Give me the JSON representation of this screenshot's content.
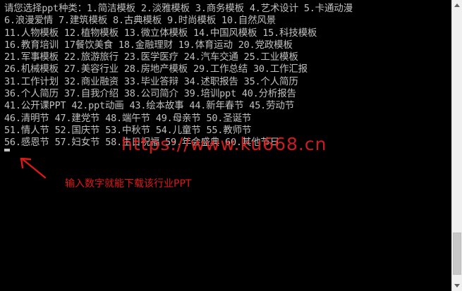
{
  "console": {
    "lines": [
      "请您选择ppt种类：1.简洁模板 2.淡雅模板 3.商务模板 4.艺术设计 5.卡通动漫",
      "6.浪漫爱情 7.建筑模板 8.古典模板 9.时尚模板 10.自然风景",
      "11.人物模板 12.植物模板 13.微立体模板 14.中国风模板 15.科技模板",
      "16.教育培训 17餐饮美食 18.金融理财 19.体育运动 20.党政模板",
      "21.军事模板 22.旅游旅行 23.医学医疗 24.汽车交通 25.工业模板",
      "26.机械模板 27.美容行业 28.房地产模板 29.工作总结 30.工作汇报",
      "31.工作计划 32.商业融资 33.毕业答辩 34.述职报告 35.个人简历",
      "36.个人简历 37.自我介绍 38.公司简介 39.培训ppt 40.分析报告",
      "41.公开课PPT 42.ppt动画 43.绘本故事 44.新年春节 45.劳动节",
      "46.清明节 47.建党节 48.端午节 49.母亲节 50.圣诞节",
      "51.情人节 52.国庆节 53.中秋节 54.儿童节 55.教师节",
      "56.感恩节 57.妇女节 58.生日祝福 59.年会盛典 60.其他节日"
    ]
  },
  "overlay": {
    "watermark": "https://www.ku668.cn",
    "annotation": "输入数字就能下载该行业PPT"
  },
  "icons": {
    "scroll_up": "scroll-up-arrow-icon",
    "scroll_down": "scroll-down-arrow-icon",
    "annotation_arrow": "red-arrow-icon"
  },
  "colors": {
    "console_background": "#000000",
    "console_text": "#c0c0c0",
    "annotation_red": "#e01818"
  }
}
